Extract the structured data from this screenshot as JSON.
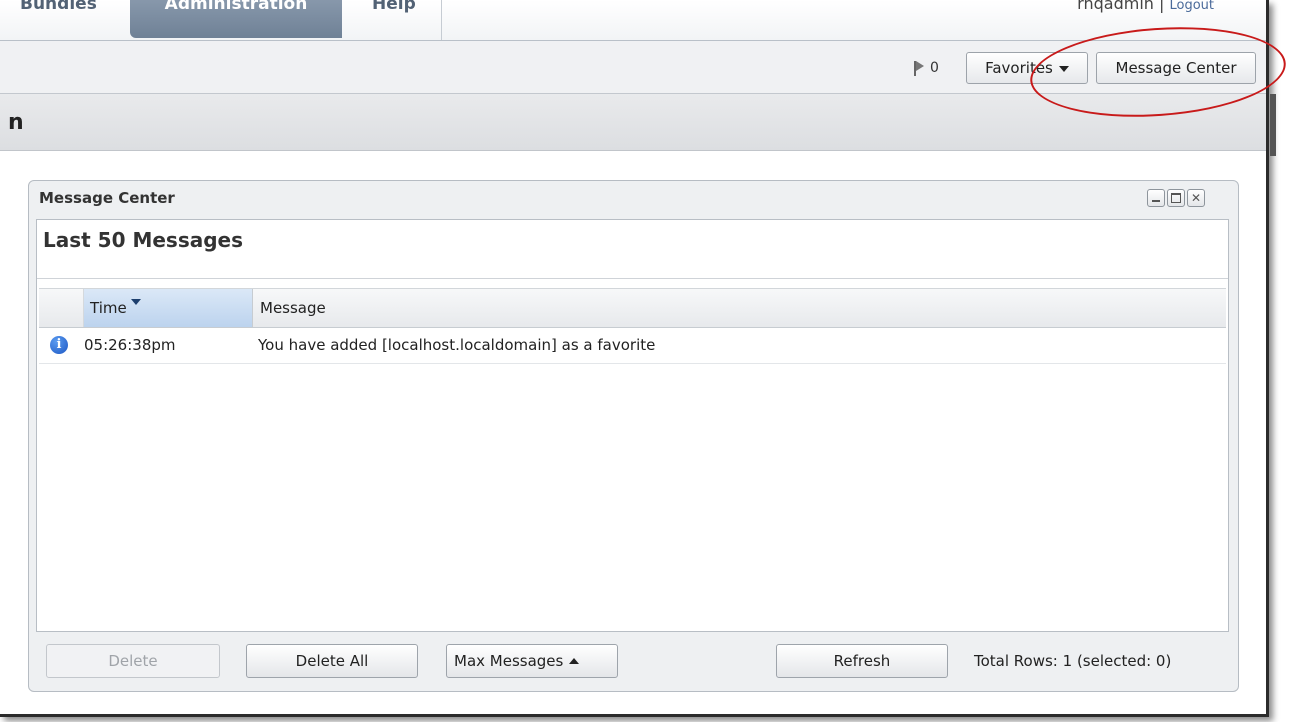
{
  "nav": {
    "tabs": [
      "Bundles",
      "Administration",
      "Help"
    ],
    "user": "rhqadmin",
    "separator": "|",
    "logout": "Logout"
  },
  "toolbar": {
    "flag_count": "0",
    "favorites_label": "Favorites",
    "message_center_label": "Message Center"
  },
  "page": {
    "title_fragment": "n"
  },
  "dialog": {
    "title": "Message Center",
    "heading": "Last 50 Messages",
    "columns": {
      "time": "Time",
      "message": "Message"
    },
    "rows": [
      {
        "icon": "info-icon",
        "time": "05:26:38pm",
        "message": "You have added [localhost.localdomain] as a favorite"
      }
    ],
    "footer": {
      "delete_label": "Delete",
      "delete_all_label": "Delete All",
      "max_messages_label": "Max Messages",
      "refresh_label": "Refresh",
      "total_rows": "Total Rows: 1 (selected: 0)"
    }
  },
  "colors": {
    "annotation": "#c81a1a",
    "selected_column": "#bcd3ee",
    "active_tab": "#7a8ca1"
  }
}
